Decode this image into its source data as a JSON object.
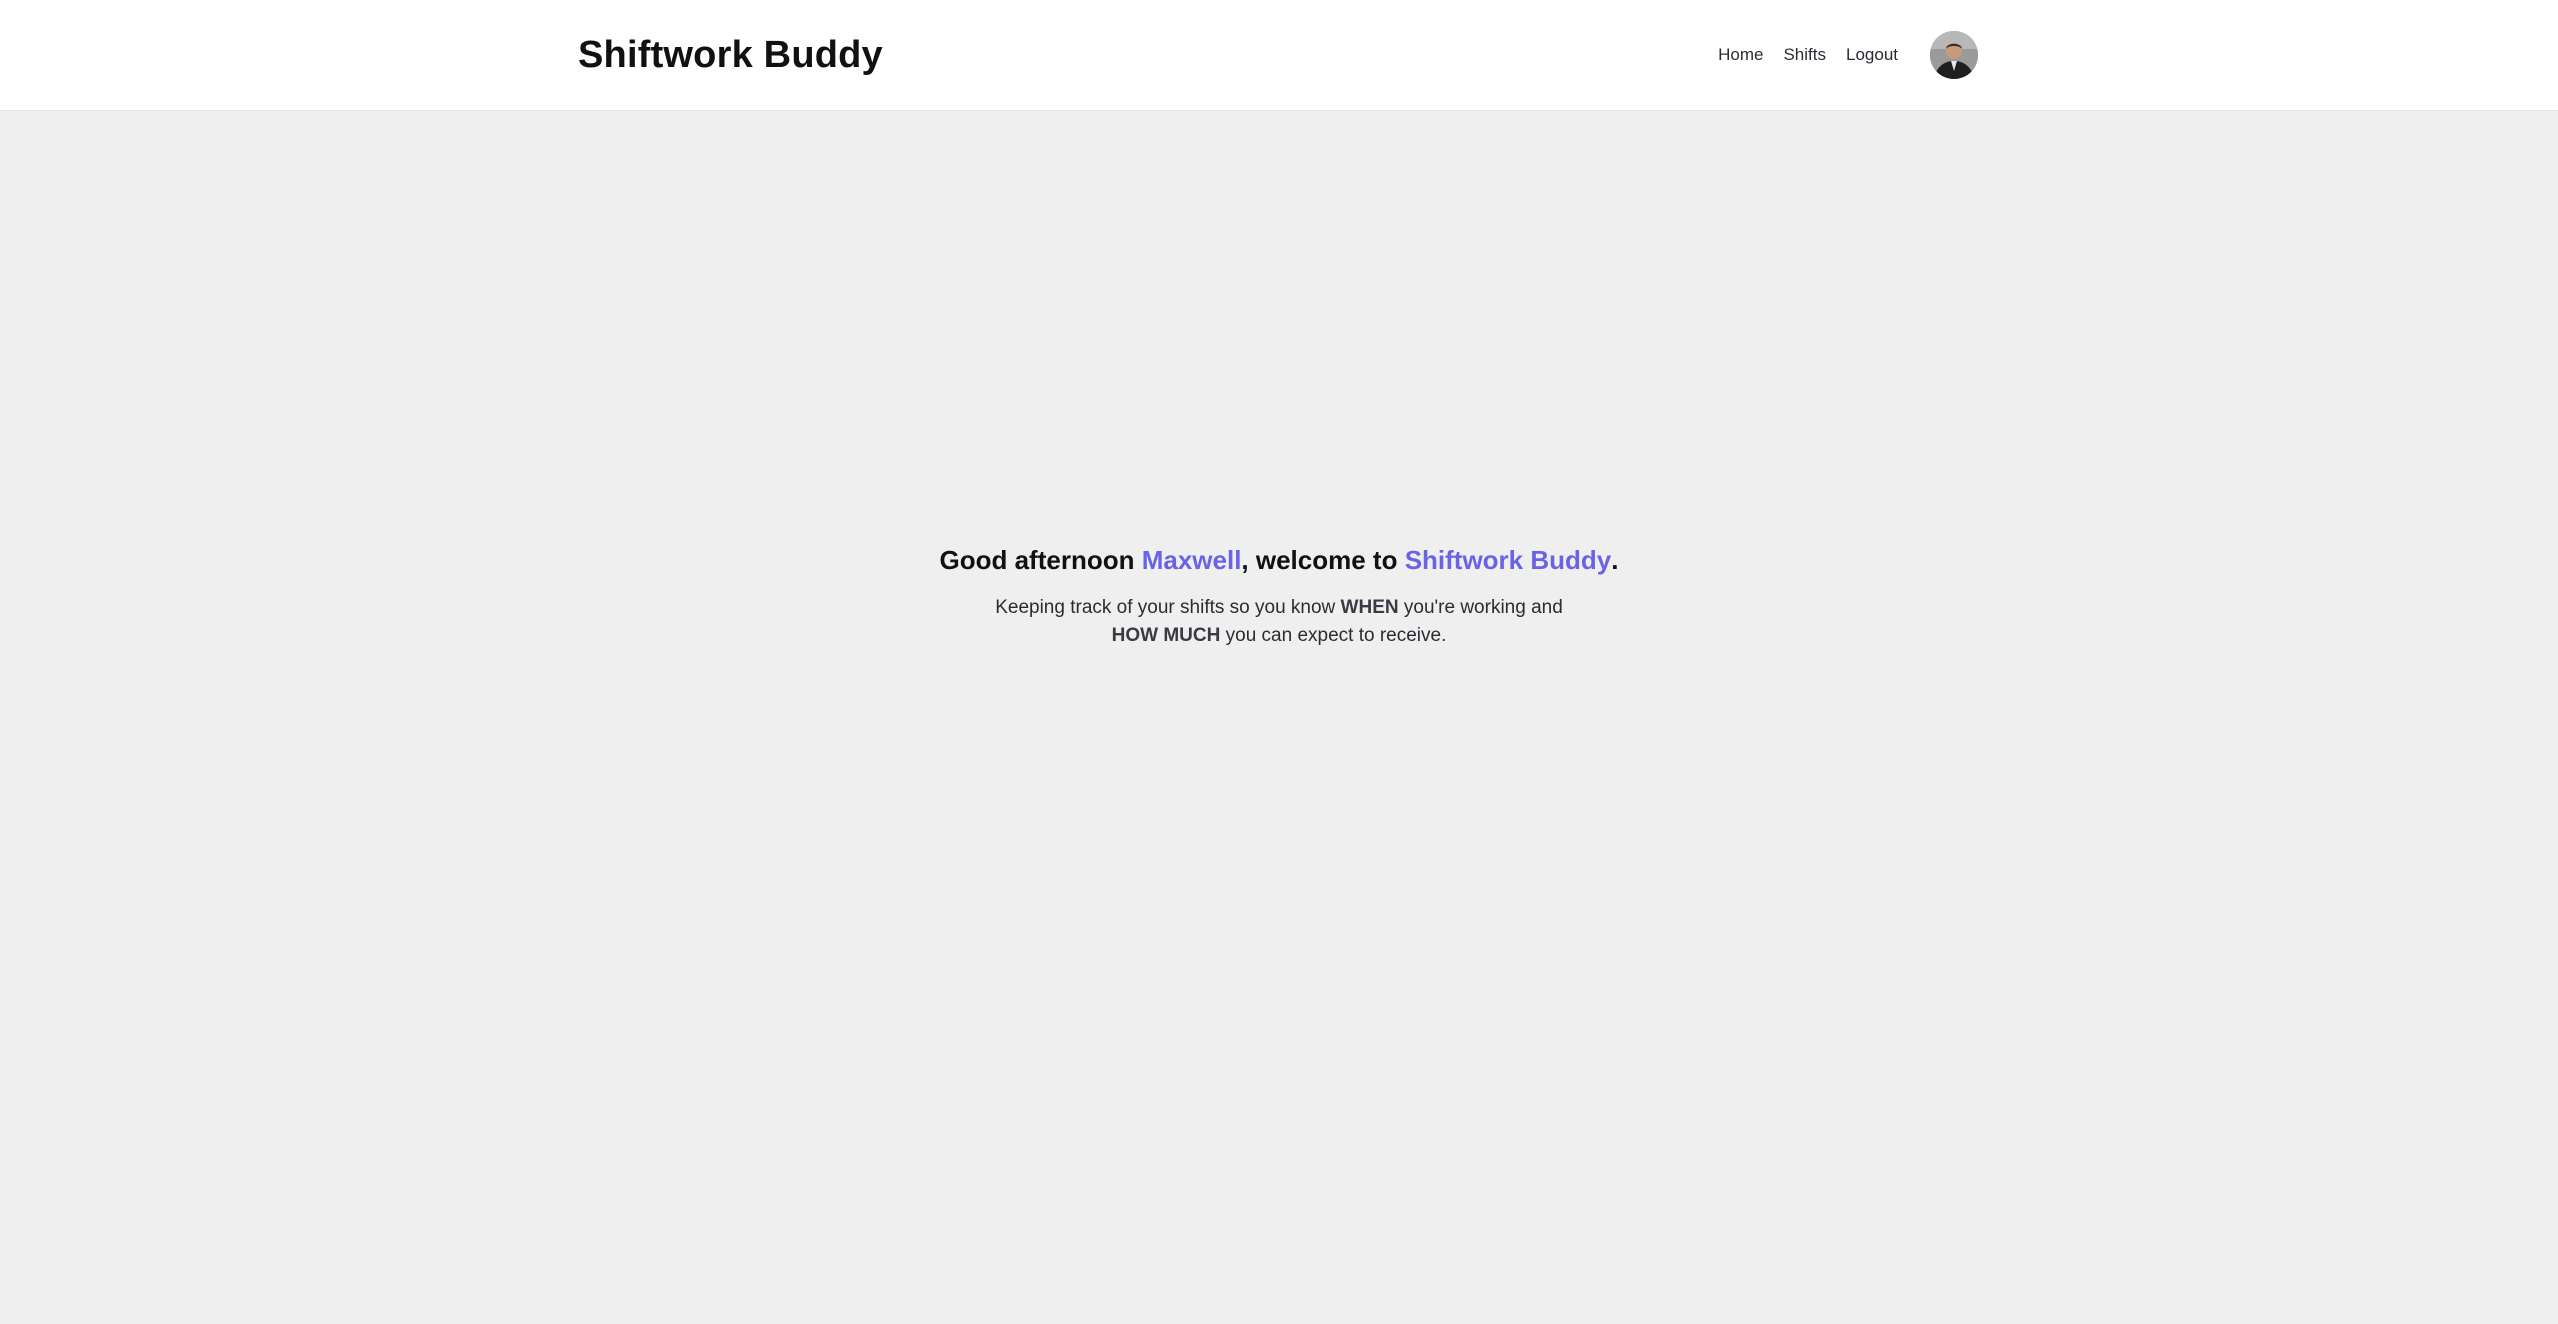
{
  "header": {
    "brand": "Shiftwork Buddy",
    "nav": {
      "home": "Home",
      "shifts": "Shifts",
      "logout": "Logout"
    },
    "avatar_icon": "user-avatar-icon"
  },
  "hero": {
    "greeting_prefix": "Good afternoon ",
    "user_name": "Maxwell",
    "greeting_middle": ", welcome to ",
    "app_name": "Shiftwork Buddy",
    "greeting_suffix": ".",
    "tagline_part1": "Keeping track of your shifts so you know ",
    "tagline_emph1": "WHEN",
    "tagline_part2": " you're working and ",
    "tagline_emph2": "HOW MUCH",
    "tagline_part3": " you can expect to receive."
  },
  "colors": {
    "accent": "#6b63e6",
    "background": "#efefef",
    "header_bg": "#ffffff"
  }
}
